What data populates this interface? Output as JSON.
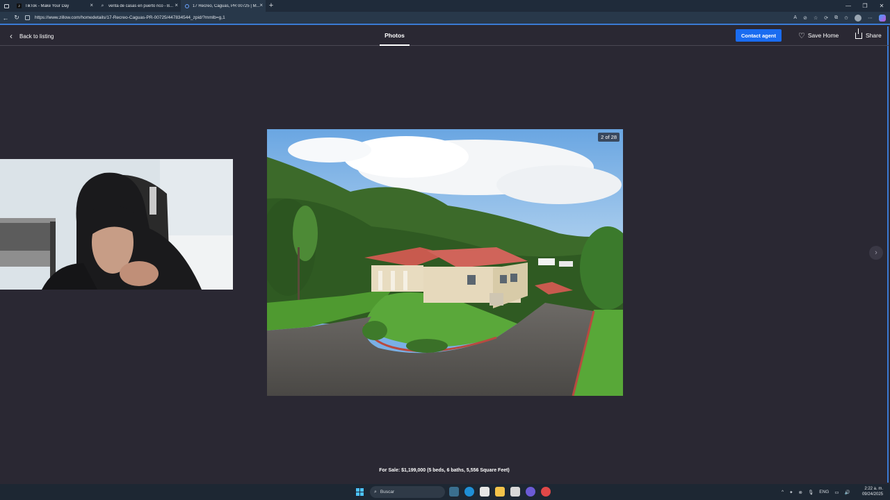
{
  "browser": {
    "tabs": [
      {
        "title": "TikTok - Make Your Day",
        "icon": "tiktok-icon",
        "active": false
      },
      {
        "title": "venta de casas en puerto rico - B...",
        "icon": "search-icon",
        "active": false
      },
      {
        "title": "17 Recreo, Caguas, PR 00725 | M...",
        "icon": "zillow-icon",
        "active": true
      }
    ],
    "url": "https://www.zillow.com/homedetails/17-Recreo-Caguas-PR-00725/447834544_zpid/?mmlb=g,1"
  },
  "page": {
    "back_label": "Back to listing",
    "photos_tab": "Photos",
    "contact_label": "Contact agent",
    "save_label": "Save Home",
    "share_label": "Share",
    "photo_counter": "2 of 28",
    "caption": "For Sale: $1,199,000 (5 beds, 6 baths, 5,556 Square Feet)"
  },
  "taskbar": {
    "search_placeholder": "Buscar",
    "lang": "ENG",
    "time": "2:22 a. m.",
    "date": "09/24/2025"
  },
  "colors": {
    "accent": "#1a6cf0",
    "page_bg": "#2a2833",
    "browser_bg": "#28384a"
  }
}
